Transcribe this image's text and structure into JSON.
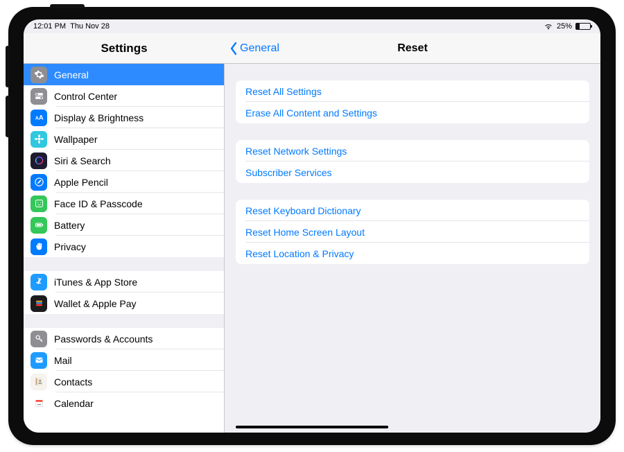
{
  "status": {
    "time": "12:01 PM",
    "date": "Thu Nov 28",
    "battery_pct": "25%"
  },
  "nav": {
    "left_title": "Settings",
    "back_label": "General",
    "right_title": "Reset"
  },
  "sidebar": {
    "groups": [
      {
        "items": [
          {
            "id": "general",
            "label": "General",
            "icon": "gear",
            "bg": "#8e8e93",
            "selected": true
          },
          {
            "id": "control-center",
            "label": "Control Center",
            "icon": "switches",
            "bg": "#8e8e93"
          },
          {
            "id": "display",
            "label": "Display & Brightness",
            "icon": "aa",
            "bg": "#007aff"
          },
          {
            "id": "wallpaper",
            "label": "Wallpaper",
            "icon": "flower",
            "bg": "#30c8e0"
          },
          {
            "id": "siri",
            "label": "Siri & Search",
            "icon": "siri",
            "bg": "#1c1c2e"
          },
          {
            "id": "pencil",
            "label": "Apple Pencil",
            "icon": "pencil",
            "bg": "#007aff"
          },
          {
            "id": "faceid",
            "label": "Face ID & Passcode",
            "icon": "face",
            "bg": "#34c759"
          },
          {
            "id": "battery",
            "label": "Battery",
            "icon": "battery",
            "bg": "#34c759"
          },
          {
            "id": "privacy",
            "label": "Privacy",
            "icon": "hand",
            "bg": "#007aff"
          }
        ]
      },
      {
        "items": [
          {
            "id": "itunes",
            "label": "iTunes & App Store",
            "icon": "appstore",
            "bg": "#1f9bff"
          },
          {
            "id": "wallet",
            "label": "Wallet & Apple Pay",
            "icon": "wallet",
            "bg": "#1c1c1e"
          }
        ]
      },
      {
        "items": [
          {
            "id": "passwords",
            "label": "Passwords & Accounts",
            "icon": "key",
            "bg": "#8e8e93"
          },
          {
            "id": "mail",
            "label": "Mail",
            "icon": "mail",
            "bg": "#1f9bff"
          },
          {
            "id": "contacts",
            "label": "Contacts",
            "icon": "contacts",
            "bg": "#f5f3ef"
          },
          {
            "id": "calendar",
            "label": "Calendar",
            "icon": "calendar",
            "bg": "#ffffff"
          }
        ]
      }
    ]
  },
  "detail": {
    "groups": [
      {
        "rows": [
          {
            "id": "reset-all",
            "label": "Reset All Settings"
          },
          {
            "id": "erase-all",
            "label": "Erase All Content and Settings"
          }
        ]
      },
      {
        "rows": [
          {
            "id": "reset-network",
            "label": "Reset Network Settings"
          },
          {
            "id": "subscriber",
            "label": "Subscriber Services"
          }
        ]
      },
      {
        "rows": [
          {
            "id": "reset-keyboard",
            "label": "Reset Keyboard Dictionary"
          },
          {
            "id": "reset-home",
            "label": "Reset Home Screen Layout"
          },
          {
            "id": "reset-location",
            "label": "Reset Location & Privacy"
          }
        ]
      }
    ]
  },
  "icon_colors": {
    "contacts_tabs": "#c7a16a",
    "calendar_red": "#ff3b30"
  }
}
